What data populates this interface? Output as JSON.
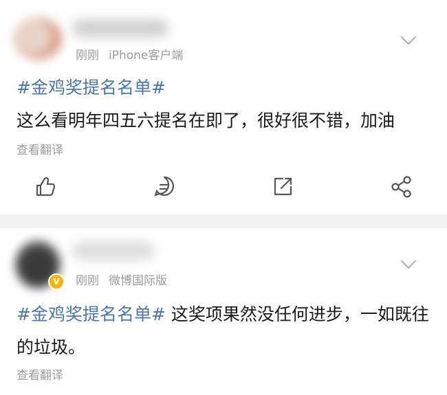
{
  "posts": [
    {
      "time": "刚刚",
      "source": "iPhone客户端",
      "hashtag": "#金鸡奖提名名单#",
      "body": "这么看明年四五六提名在即了，很好很不错，加油",
      "translate_label": "查看翻译",
      "actions": [
        "like-icon",
        "comment-icon",
        "repost-icon",
        "share-icon"
      ]
    },
    {
      "time": "刚刚",
      "source": "微博国际版",
      "verified_badge": "V",
      "hashtag": "#金鸡奖提名名单#",
      "body": " 这奖项果然没任何进步，一如既往的垃圾。",
      "translate_label": "查看翻译"
    }
  ],
  "colors": {
    "hashtag": "#4a76b6",
    "meta_text": "#9b9b9b",
    "verified": "#f7b500",
    "background": "#f2f2f2"
  }
}
